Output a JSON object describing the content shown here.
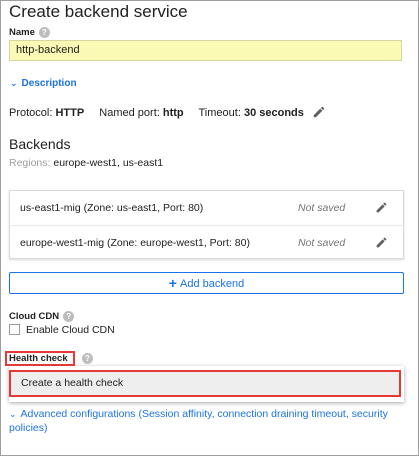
{
  "page": {
    "title": "Create backend service"
  },
  "name_field": {
    "label": "Name",
    "value": "http-backend"
  },
  "description": {
    "toggle_label": "Description"
  },
  "protocol": {
    "protocol_label": "Protocol:",
    "protocol_value": "HTTP",
    "port_label": "Named port:",
    "port_value": "http",
    "timeout_label": "Timeout:",
    "timeout_value": "30 seconds"
  },
  "backends": {
    "title": "Backends",
    "regions_label": "Regions:",
    "regions_value": "europe-west1, us-east1",
    "items": [
      {
        "name": "us-east1-mig (Zone: us-east1, Port: 80)",
        "status": "Not saved"
      },
      {
        "name": "europe-west1-mig (Zone: europe-west1, Port: 80)",
        "status": "Not saved"
      }
    ],
    "add_label": "Add backend"
  },
  "cdn": {
    "label": "Cloud CDN",
    "checkbox_label": "Enable Cloud CDN",
    "checked": false
  },
  "health_check": {
    "label": "Health check",
    "option": "Create a health check"
  },
  "advanced": {
    "label": "Advanced configurations (Session affinity, connection draining timeout, security policies)"
  },
  "icons": {
    "help": "help-icon",
    "edit": "pencil-icon",
    "expand": "chevron-down-icon",
    "add": "plus-icon"
  },
  "colors": {
    "accent": "#1a73e8",
    "highlight_input": "#fafab4",
    "annotation_red": "#e53935"
  }
}
